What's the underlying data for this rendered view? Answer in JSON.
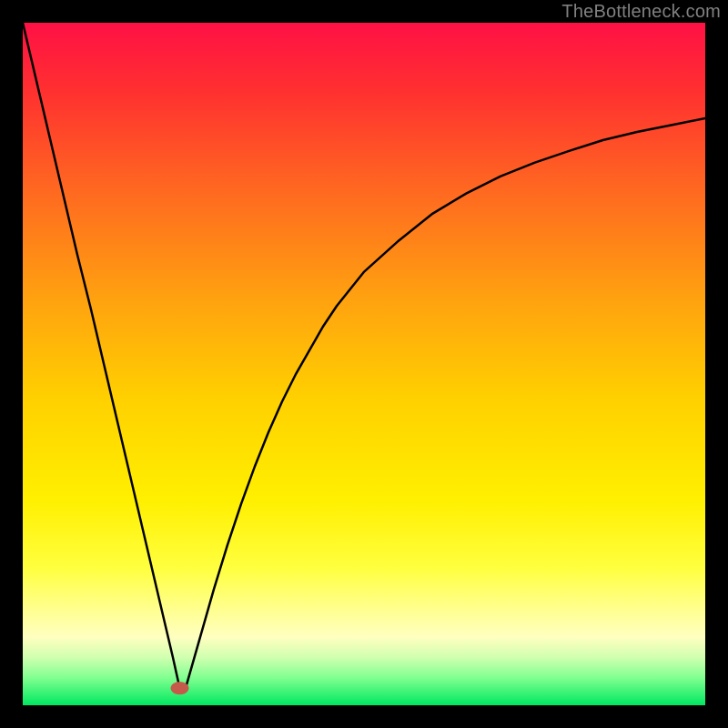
{
  "watermark": "TheBottleneck.com",
  "chart_data": {
    "type": "line",
    "title": "",
    "xlabel": "",
    "ylabel": "",
    "xlim": [
      0,
      100
    ],
    "ylim": [
      0,
      100
    ],
    "x": [
      0,
      2,
      4,
      6,
      8,
      10,
      12,
      14,
      16,
      18,
      20,
      22,
      23,
      24,
      26,
      28,
      30,
      32,
      34,
      36,
      38,
      40,
      42,
      44,
      46,
      48,
      50,
      55,
      60,
      65,
      70,
      75,
      80,
      85,
      90,
      95,
      100
    ],
    "values": [
      100,
      91.5,
      83,
      74.5,
      66,
      58,
      49.5,
      41,
      32.5,
      24,
      15.5,
      7,
      2.5,
      3,
      10,
      17,
      23.5,
      29.5,
      35,
      40,
      44.5,
      48.5,
      52,
      55.5,
      58.5,
      61,
      63.5,
      68,
      72,
      75,
      77.5,
      79.5,
      81.2,
      82.8,
      84,
      85,
      86
    ],
    "marker": {
      "x": 23,
      "y": 2.5
    },
    "gradient_stops": [
      {
        "offset": 0.0,
        "color": "#ff1045"
      },
      {
        "offset": 0.1,
        "color": "#ff3030"
      },
      {
        "offset": 0.25,
        "color": "#ff6a20"
      },
      {
        "offset": 0.4,
        "color": "#ffa010"
      },
      {
        "offset": 0.55,
        "color": "#ffd000"
      },
      {
        "offset": 0.7,
        "color": "#fff000"
      },
      {
        "offset": 0.8,
        "color": "#ffff40"
      },
      {
        "offset": 0.86,
        "color": "#ffff90"
      },
      {
        "offset": 0.9,
        "color": "#ffffc0"
      },
      {
        "offset": 0.93,
        "color": "#d0ffb0"
      },
      {
        "offset": 0.96,
        "color": "#80ff90"
      },
      {
        "offset": 1.0,
        "color": "#00e860"
      }
    ]
  }
}
